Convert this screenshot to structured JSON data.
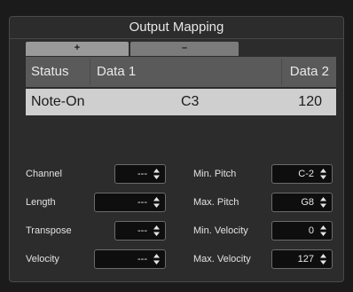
{
  "window": {
    "title": "Output Mapping"
  },
  "tabs": {
    "add_label": "+",
    "remove_label": "–"
  },
  "table": {
    "headers": {
      "status": "Status",
      "data1": "Data 1",
      "data2": "Data 2"
    },
    "rows": [
      {
        "status": "Note-On",
        "data1": "C3",
        "data2": "120"
      }
    ]
  },
  "fields": {
    "channel": {
      "label": "Channel",
      "value": "---"
    },
    "length": {
      "label": "Length",
      "value": "---"
    },
    "transpose": {
      "label": "Transpose",
      "value": "---"
    },
    "velocity": {
      "label": "Velocity",
      "value": "---"
    },
    "min_pitch": {
      "label": "Min. Pitch",
      "value": "C-2"
    },
    "max_pitch": {
      "label": "Max. Pitch",
      "value": "G8"
    },
    "min_velocity": {
      "label": "Min. Velocity",
      "value": "0"
    },
    "max_velocity": {
      "label": "Max. Velocity",
      "value": "127"
    }
  }
}
